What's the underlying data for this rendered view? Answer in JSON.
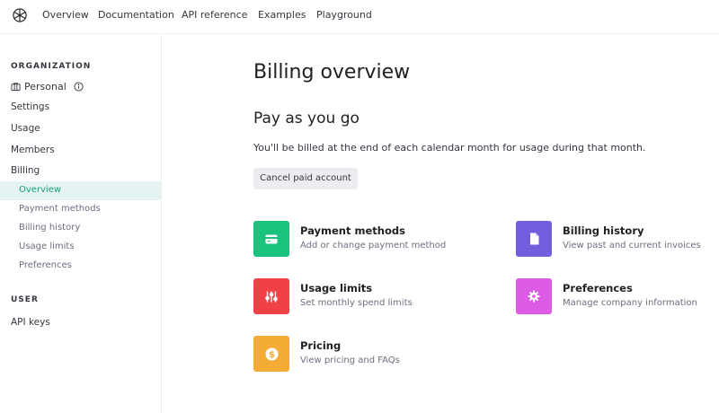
{
  "nav": {
    "links": [
      "Overview",
      "Documentation",
      "API reference",
      "Examples",
      "Playground"
    ]
  },
  "sidebar": {
    "org_heading": "ORGANIZATION",
    "org_name": "Personal",
    "items": [
      "Settings",
      "Usage",
      "Members",
      "Billing"
    ],
    "billing_sub": [
      "Overview",
      "Payment methods",
      "Billing history",
      "Usage limits",
      "Preferences"
    ],
    "active_sub": "Overview",
    "user_heading": "USER",
    "user_items": [
      "API keys"
    ]
  },
  "main": {
    "title": "Billing overview",
    "section_title": "Pay as you go",
    "description": "You'll be billed at the end of each calendar month for usage during that month.",
    "cancel_label": "Cancel paid account",
    "cards": [
      {
        "title": "Payment methods",
        "subtitle": "Add or change payment method",
        "icon": "credit-card-icon",
        "color": "#19c37d"
      },
      {
        "title": "Billing history",
        "subtitle": "View past and current invoices",
        "icon": "document-icon",
        "color": "#715fde"
      },
      {
        "title": "Usage limits",
        "subtitle": "Set monthly spend limits",
        "icon": "sliders-icon",
        "color": "#ef4146"
      },
      {
        "title": "Preferences",
        "subtitle": "Manage company information",
        "icon": "gear-icon",
        "color": "#dd5ce5"
      },
      {
        "title": "Pricing",
        "subtitle": "View pricing and FAQs",
        "icon": "dollar-icon",
        "color": "#f4ac36"
      }
    ]
  },
  "colors": {
    "accent": "#10a37f",
    "active_bg": "#e6f3f3"
  }
}
